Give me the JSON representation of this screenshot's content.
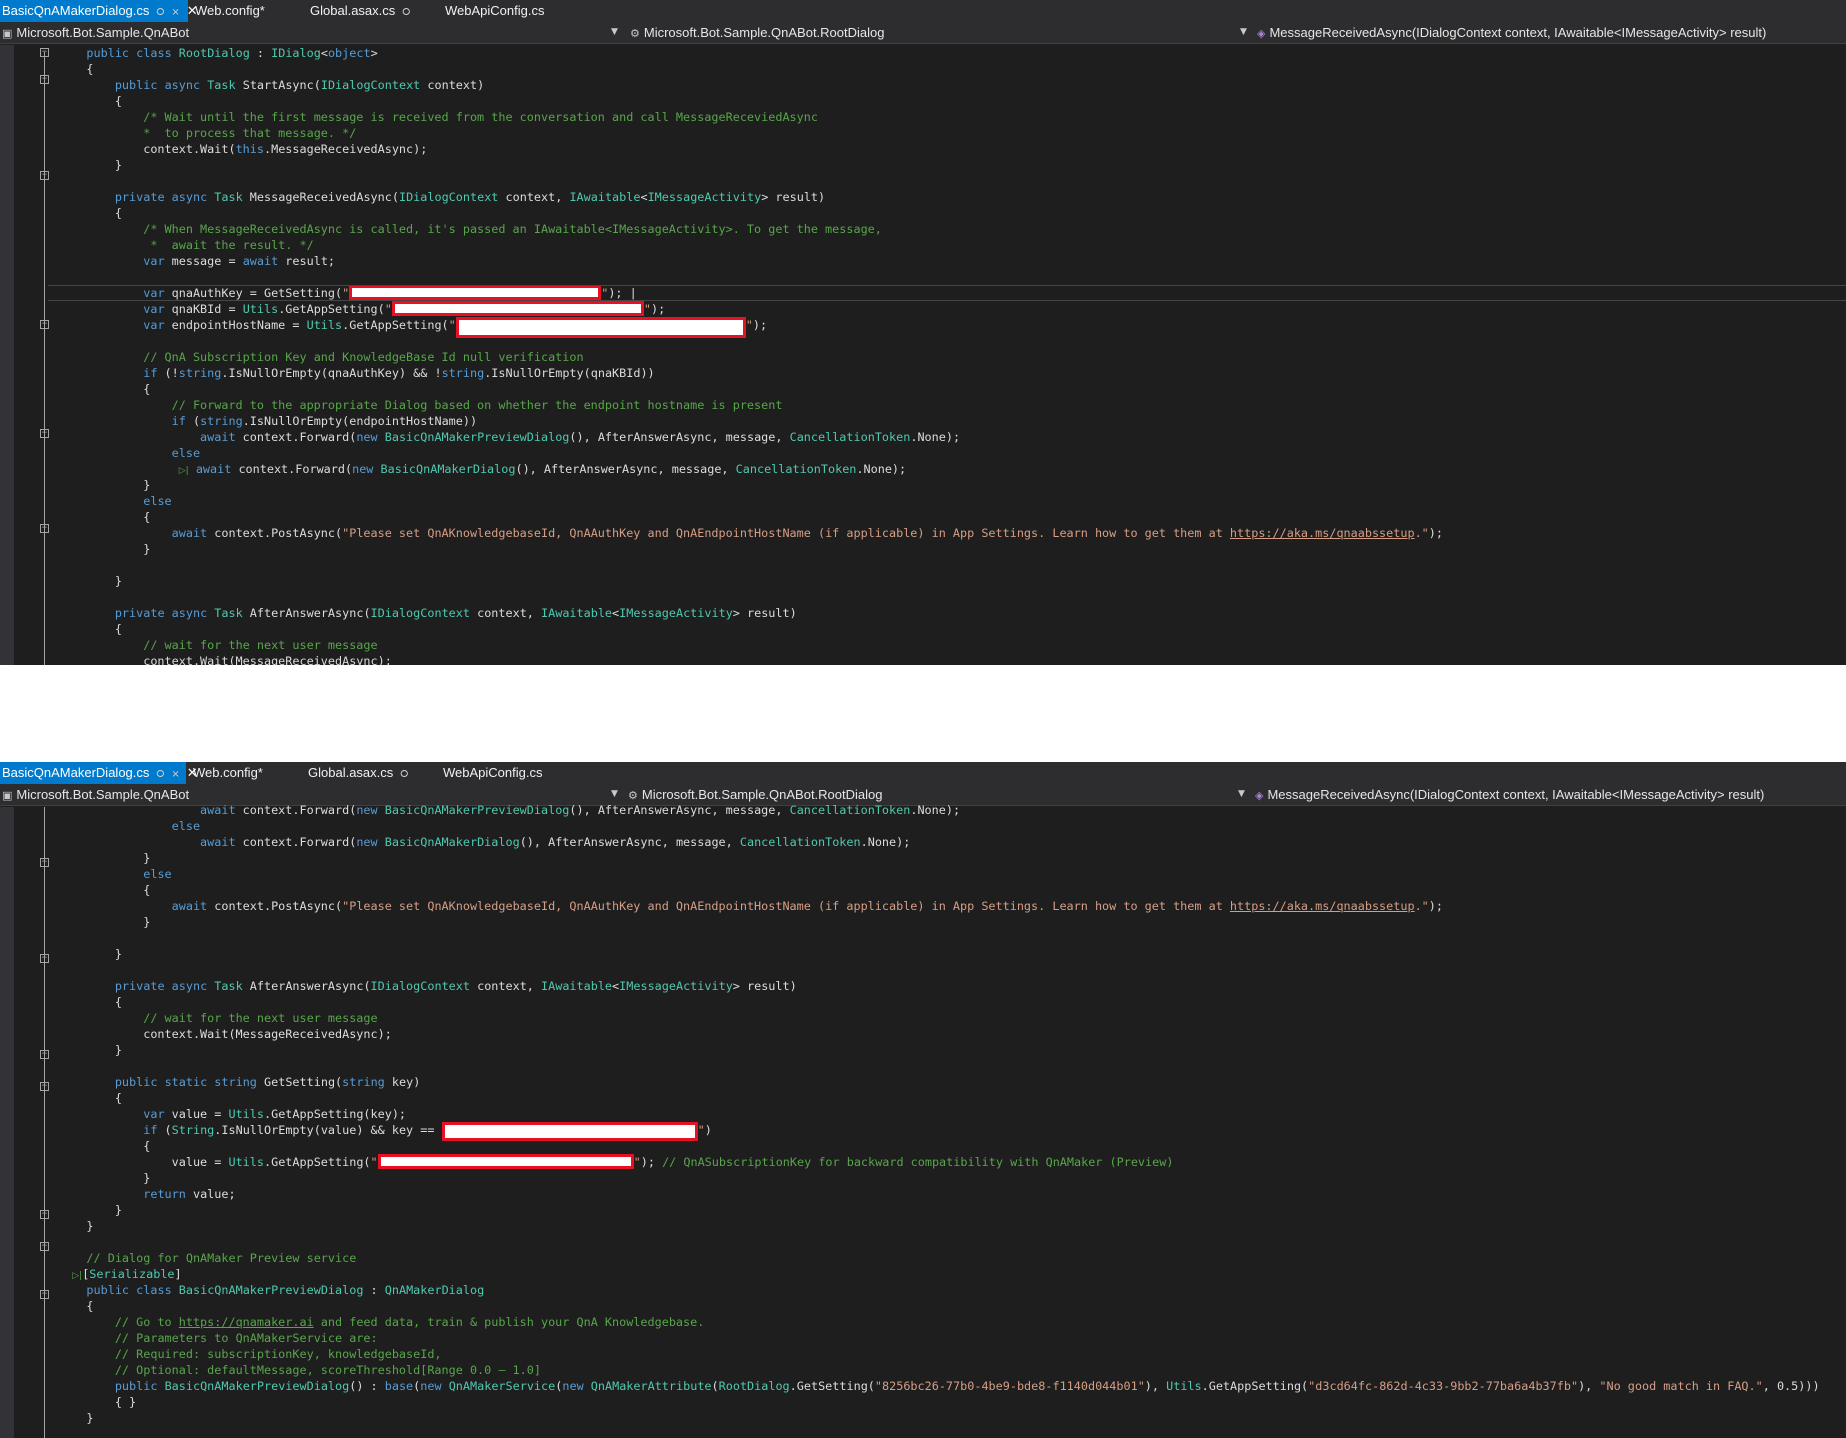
{
  "tabs": [
    {
      "label": "BasicQnAMakerDialog.cs",
      "active": true,
      "icons": [
        "⭘",
        "⨯"
      ],
      "close": "✕"
    },
    {
      "label": "Web.config*"
    },
    {
      "label": "Global.asax.cs",
      "pin": "⭘"
    },
    {
      "label": "WebApiConfig.cs"
    }
  ],
  "navbar": {
    "project": "Microsoft.Bot.Sample.QnABot",
    "class": "Microsoft.Bot.Sample.QnABot.RootDialog",
    "member": "MessageReceivedAsync(IDialogContext context, IAwaitable<IMessageActivity> result)"
  },
  "code": {
    "s_wait_cmt1": "/* Wait until the first message is received from the conversation and call MessageReceviedAsync",
    "s_wait_cmt2": "*  to process that message. */",
    "s_when_cmt1": "/* When MessageReceivedAsync is called, it's passed an IAwaitable<IMessageActivity>. To get the message,",
    "s_when_cmt2": "*  await the result. */",
    "s_null_cmt": "// QnA Subscription Key and KnowledgeBase Id null verification",
    "s_fwd_cmt": "// Forward to the appropriate Dialog based on whether the endpoint hostname is present",
    "s_post_str": "\"Please set QnAKnowledgebaseId, QnAAuthKey and QnAEndpointHostName (if applicable) in App Settings. Learn how to get them at ",
    "s_url": "https://aka.ms/qnaabssetup",
    "s_post_end": ".\"",
    "s_wait_next": "// wait for the next user message",
    "s_compat_cmt": "// QnASubscriptionKey for backward compatibility with QnAMaker (Preview)",
    "s_dialog_cmt": "// Dialog for QnAMaker Preview service",
    "s_goto_pre": "// Go to ",
    "s_qnamaker_url": "https://qnamaker.ai",
    "s_goto_post": " and feed data, train & publish your QnA Knowledgebase.",
    "s_params_cmt": "// Parameters to QnAMakerService are:",
    "s_req_cmt": "// Required: subscriptionKey, knowledgebaseId,",
    "s_opt_cmt": "// Optional: defaultMessage, scoreThreshold[Range 0.0 – 1.0]",
    "s_guid1": "\"8256bc26-77b0-4be9-bde8-f1140d044b01\"",
    "s_guid2": "\"d3cd64fc-862d-4c33-9bb2-77ba6a4b37fb\"",
    "s_nomatch": "\"No good match in FAQ.\""
  },
  "colors": {
    "background": "#1e1e1e",
    "keyword": "#569cd6",
    "type": "#4ec9b0",
    "comment": "#57a64a",
    "string": "#d69d85",
    "text": "#dcdcdc",
    "active_tab": "#007acc",
    "redaction": "#e81123"
  }
}
